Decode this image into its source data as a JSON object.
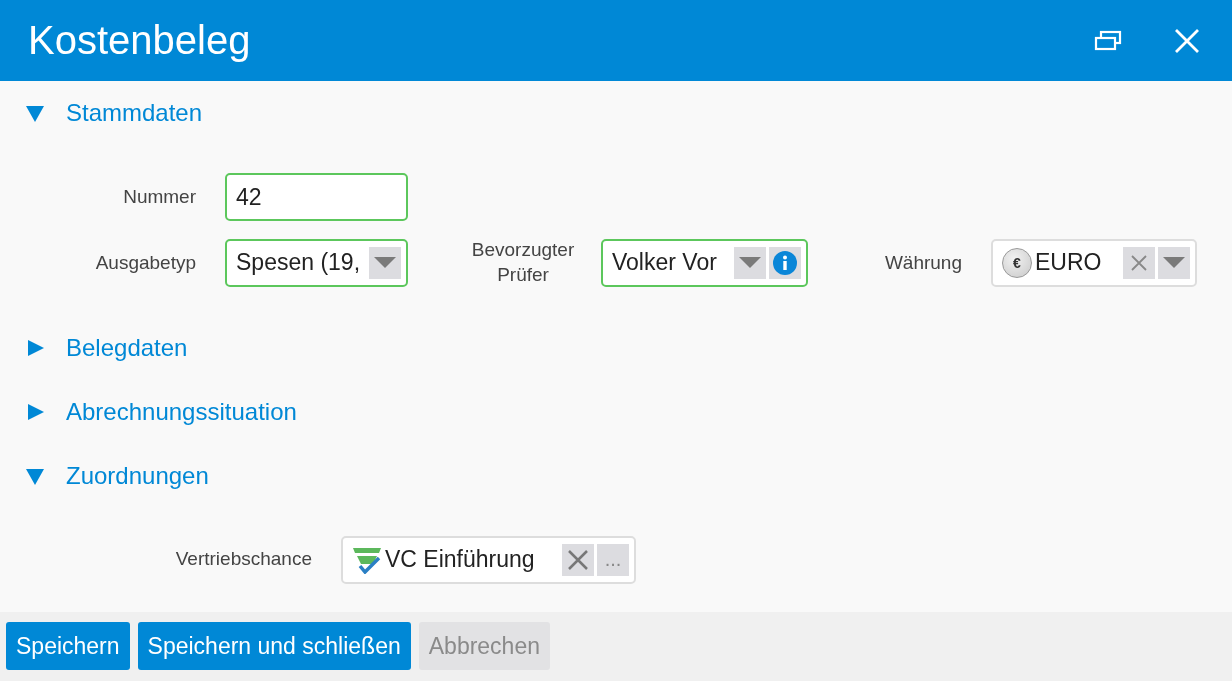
{
  "window": {
    "title": "Kostenbeleg"
  },
  "sections": [
    {
      "title": "Stammdaten",
      "expanded": true,
      "rows": [
        [
          {
            "kind": "text",
            "label": "Nummer",
            "value": "42",
            "valid": true
          }
        ],
        [
          {
            "kind": "select",
            "label": "Ausgabetyp",
            "value": "Spesen (19,",
            "valid": true
          },
          {
            "kind": "lookup",
            "label": "Bevorzugter Prüfer",
            "value": "Volker Vor",
            "valid": true
          },
          {
            "kind": "currency",
            "label": "Währung",
            "symbol": "€",
            "value": "EURO",
            "valid": false
          }
        ]
      ]
    },
    {
      "title": "Belegdaten",
      "expanded": false
    },
    {
      "title": "Abrechnungssituation",
      "expanded": false
    },
    {
      "title": "Zuordnungen",
      "expanded": true,
      "rows": [
        [
          {
            "kind": "link",
            "label": "Vertriebschance",
            "value": "VC Einführung",
            "valid": false,
            "more": "..."
          }
        ]
      ]
    }
  ],
  "buttons": [
    {
      "label": "Speichern",
      "disabled": false
    },
    {
      "label": "Speichern und schließen",
      "disabled": false
    },
    {
      "label": "Abbrechen",
      "disabled": true
    }
  ]
}
